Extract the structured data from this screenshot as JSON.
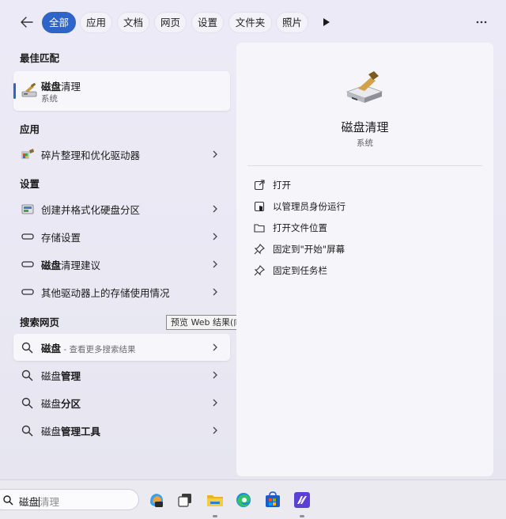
{
  "tabs": [
    {
      "label": "全部",
      "active": true
    },
    {
      "label": "应用"
    },
    {
      "label": "文档"
    },
    {
      "label": "网页"
    },
    {
      "label": "设置"
    },
    {
      "label": "文件夹"
    },
    {
      "label": "照片"
    }
  ],
  "sections": {
    "best_match": "最佳匹配",
    "apps": "应用",
    "settings": "设置",
    "web": "搜索网页"
  },
  "best_match": {
    "title_bold": "磁盘",
    "title_rest": "清理",
    "subtitle": "系统"
  },
  "apps": [
    {
      "label": "碎片整理和优化驱动器",
      "icon": "defrag-icon"
    }
  ],
  "settings": [
    {
      "label": "创建并格式化硬盘分区",
      "icon": "disk-management-icon"
    },
    {
      "label": "存储设置",
      "icon": "storage-icon"
    },
    {
      "bold": "磁盘",
      "rest": "清理建议",
      "icon": "storage-icon"
    },
    {
      "label": "其他驱动器上的存储使用情况",
      "icon": "storage-icon"
    }
  ],
  "web": [
    {
      "bold": "磁盘",
      "rest": " - 查看更多搜索结果"
    },
    {
      "plain": "磁盘",
      "bold": "管理"
    },
    {
      "plain": "磁盘",
      "bold": "分区"
    },
    {
      "plain": "磁盘",
      "bold": "管理工具"
    }
  ],
  "tooltip": "预览 Web 结果(向右键)",
  "detail": {
    "title": "磁盘清理",
    "subtitle": "系统",
    "actions": [
      {
        "label": "打开",
        "icon": "open-external-icon"
      },
      {
        "label": "以管理员身份运行",
        "icon": "shield-admin-icon"
      },
      {
        "label": "打开文件位置",
        "icon": "folder-icon"
      },
      {
        "label": "固定到\"开始\"屏幕",
        "icon": "pin-icon"
      },
      {
        "label": "固定到任务栏",
        "icon": "pin-icon"
      }
    ]
  },
  "taskbar": {
    "search_typed": "磁盘",
    "search_hint": "清理",
    "icons": [
      "copilot-icon",
      "task-view-icon",
      "file-explorer-icon",
      "edge-icon",
      "microsoft-store-icon",
      "visual-studio-icon"
    ]
  },
  "colors": {
    "accent": "#2f64c8"
  }
}
